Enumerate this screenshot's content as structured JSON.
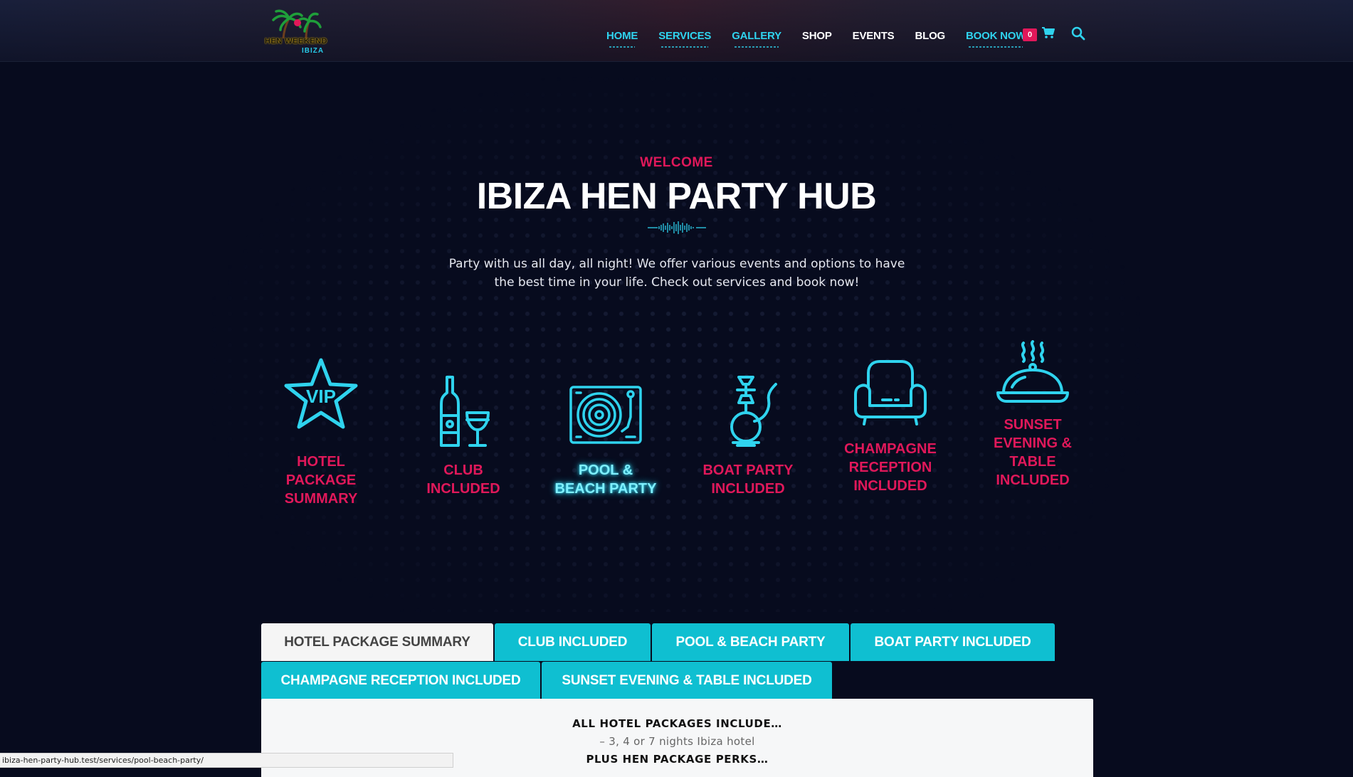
{
  "header": {
    "logo": {
      "text": "HEN WEEKEND",
      "sub": "IBIZA"
    },
    "nav": [
      {
        "label": "Home",
        "name": "nav-home",
        "highlight": true
      },
      {
        "label": "Services",
        "name": "nav-services",
        "highlight": true
      },
      {
        "label": "Gallery",
        "name": "nav-gallery",
        "highlight": true
      },
      {
        "label": "Shop",
        "name": "nav-shop",
        "highlight": false
      },
      {
        "label": "Events",
        "name": "nav-events",
        "highlight": false
      },
      {
        "label": "Blog",
        "name": "nav-blog",
        "highlight": false
      },
      {
        "label": "Book Now",
        "name": "nav-book-now",
        "highlight": true
      }
    ],
    "cart_count": "0",
    "icons": {
      "cart": "cart-icon",
      "search": "search-icon"
    }
  },
  "hero": {
    "eyebrow": "WELCOME",
    "title": "IBIZA HEN PARTY HUB",
    "intro": "Party with us all day, all night! We offer various events and options to have the best time in your life. Check out services and book now!"
  },
  "services": [
    {
      "line1": "Hotel",
      "line2": "Package",
      "line3": "Summary",
      "icon": "vip-star-icon",
      "active": false
    },
    {
      "line1": "Club",
      "line2": "Included",
      "line3": "",
      "icon": "bottle-glass-icon",
      "active": false
    },
    {
      "line1": "Pool &",
      "line2": "Beach Party",
      "line3": "",
      "icon": "turntable-icon",
      "active": true
    },
    {
      "line1": "Boat Party",
      "line2": "Included",
      "line3": "",
      "icon": "hookah-icon",
      "active": false
    },
    {
      "line1": "Champagne",
      "line2": "Reception",
      "line3": "Included",
      "icon": "armchair-icon",
      "active": false
    },
    {
      "line1": "Sunset",
      "line2": "Evening &",
      "line3": "Table",
      "line4": "Included",
      "icon": "cloche-icon",
      "active": false
    }
  ],
  "tabs": {
    "row1": [
      "HOTEL PACKAGE SUMMARY",
      "CLUB INCLUDED",
      "POOL & BEACH PARTY",
      "BOAT PARTY INCLUDED"
    ],
    "row2": [
      "CHAMPAGNE RECEPTION INCLUDED",
      "SUNSET EVENING & TABLE INCLUDED"
    ],
    "active": "HOTEL PACKAGE SUMMARY"
  },
  "panel": {
    "title": "ALL HOTEL PACKAGES INCLUDE…",
    "line": "– 3, 4 or 7 nights Ibiza hotel",
    "subtitle": "PLUS HEN PACKAGE PERKS…"
  },
  "status_bar": {
    "url": "ibiza-hen-party-hub.test/services/pool-beach-party/"
  },
  "colors": {
    "background": "#070b1e",
    "accent_pink": "#e0185a",
    "accent_cyan": "#0fbfd1",
    "neon_cyan": "#2fd3ee"
  }
}
